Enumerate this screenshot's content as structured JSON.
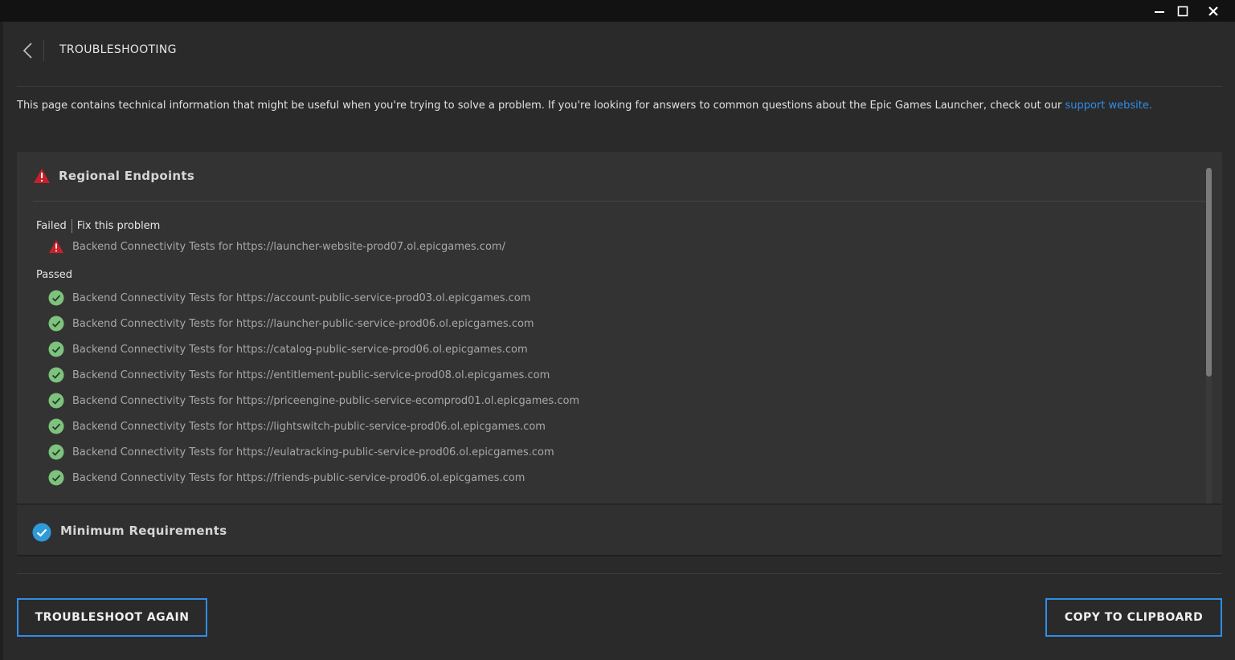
{
  "window": {
    "controls": [
      "minimize-icon",
      "maximize-icon",
      "close-icon"
    ]
  },
  "header": {
    "title": "TROUBLESHOOTING",
    "back_icon": "chevron-left-icon"
  },
  "intro": {
    "text": "This page contains technical information that might be useful when you're trying to solve a problem. If you're looking for answers to common questions about the Epic Games Launcher, check out our ",
    "link": "support website."
  },
  "regional": {
    "title": "Regional Endpoints",
    "status_icon": "warning-icon",
    "failed_label": "Failed",
    "fix_label": "Fix this problem",
    "failed_items": [
      "Backend Connectivity Tests for https://launcher-website-prod07.ol.epicgames.com/"
    ],
    "passed_label": "Passed",
    "passed_items": [
      "Backend Connectivity Tests for https://account-public-service-prod03.ol.epicgames.com",
      "Backend Connectivity Tests for https://launcher-public-service-prod06.ol.epicgames.com",
      "Backend Connectivity Tests for https://catalog-public-service-prod06.ol.epicgames.com",
      "Backend Connectivity Tests for https://entitlement-public-service-prod08.ol.epicgames.com",
      "Backend Connectivity Tests for https://priceengine-public-service-ecomprod01.ol.epicgames.com",
      "Backend Connectivity Tests for https://lightswitch-public-service-prod06.ol.epicgames.com",
      "Backend Connectivity Tests for https://eulatracking-public-service-prod06.ol.epicgames.com",
      "Backend Connectivity Tests for https://friends-public-service-prod06.ol.epicgames.com"
    ]
  },
  "min_req": {
    "title": "Minimum Requirements",
    "status_icon": "check-circle-icon"
  },
  "footer": {
    "troubleshoot_label": "TROUBLESHOOT AGAIN",
    "copy_label": "COPY TO CLIPBOARD"
  },
  "colors": {
    "accent": "#2f8ee8",
    "success": "#7dc27d",
    "error": "#c8202b"
  }
}
